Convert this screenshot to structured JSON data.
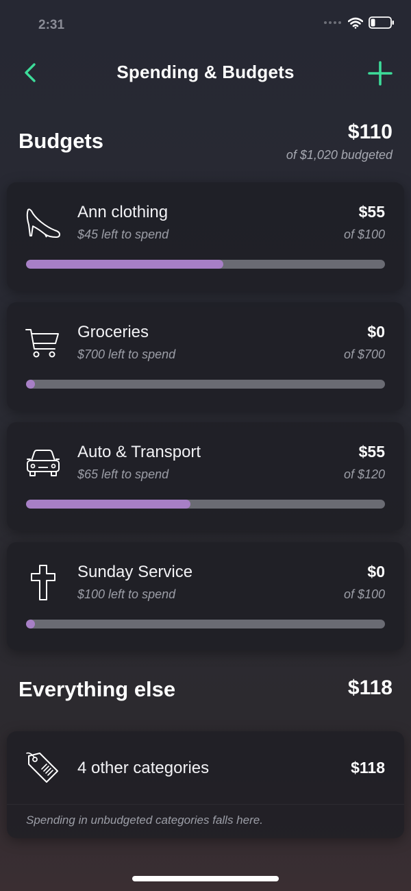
{
  "status": {
    "time": "2:31"
  },
  "nav": {
    "title": "Spending & Budgets",
    "back_icon": "chevron-left-icon",
    "add_icon": "plus-icon",
    "accent_color": "#3ddc9a"
  },
  "budgets": {
    "title": "Budgets",
    "total_spent": "$110",
    "total_budgeted_text": "of $1,020 budgeted",
    "progress_color": "#a77fc6",
    "items": [
      {
        "icon": "high-heel-shoe-icon",
        "name": "Ann clothing",
        "left_text": "$45 left to spend",
        "spent": "$55",
        "of_text": "of $100",
        "progress": 0.55
      },
      {
        "icon": "shopping-cart-icon",
        "name": "Groceries",
        "left_text": "$700 left to spend",
        "spent": "$0",
        "of_text": "of $700",
        "progress": 0
      },
      {
        "icon": "car-icon",
        "name": "Auto & Transport",
        "left_text": "$65 left to spend",
        "spent": "$55",
        "of_text": "of $120",
        "progress": 0.458
      },
      {
        "icon": "cross-icon",
        "name": "Sunday Service",
        "left_text": "$100 left to spend",
        "spent": "$0",
        "of_text": "of $100",
        "progress": 0
      }
    ]
  },
  "everything_else": {
    "title": "Everything else",
    "total": "$118",
    "card": {
      "icon": "price-tag-icon",
      "name": "4 other categories",
      "amount": "$118",
      "note": "Spending in unbudgeted categories falls here."
    }
  }
}
